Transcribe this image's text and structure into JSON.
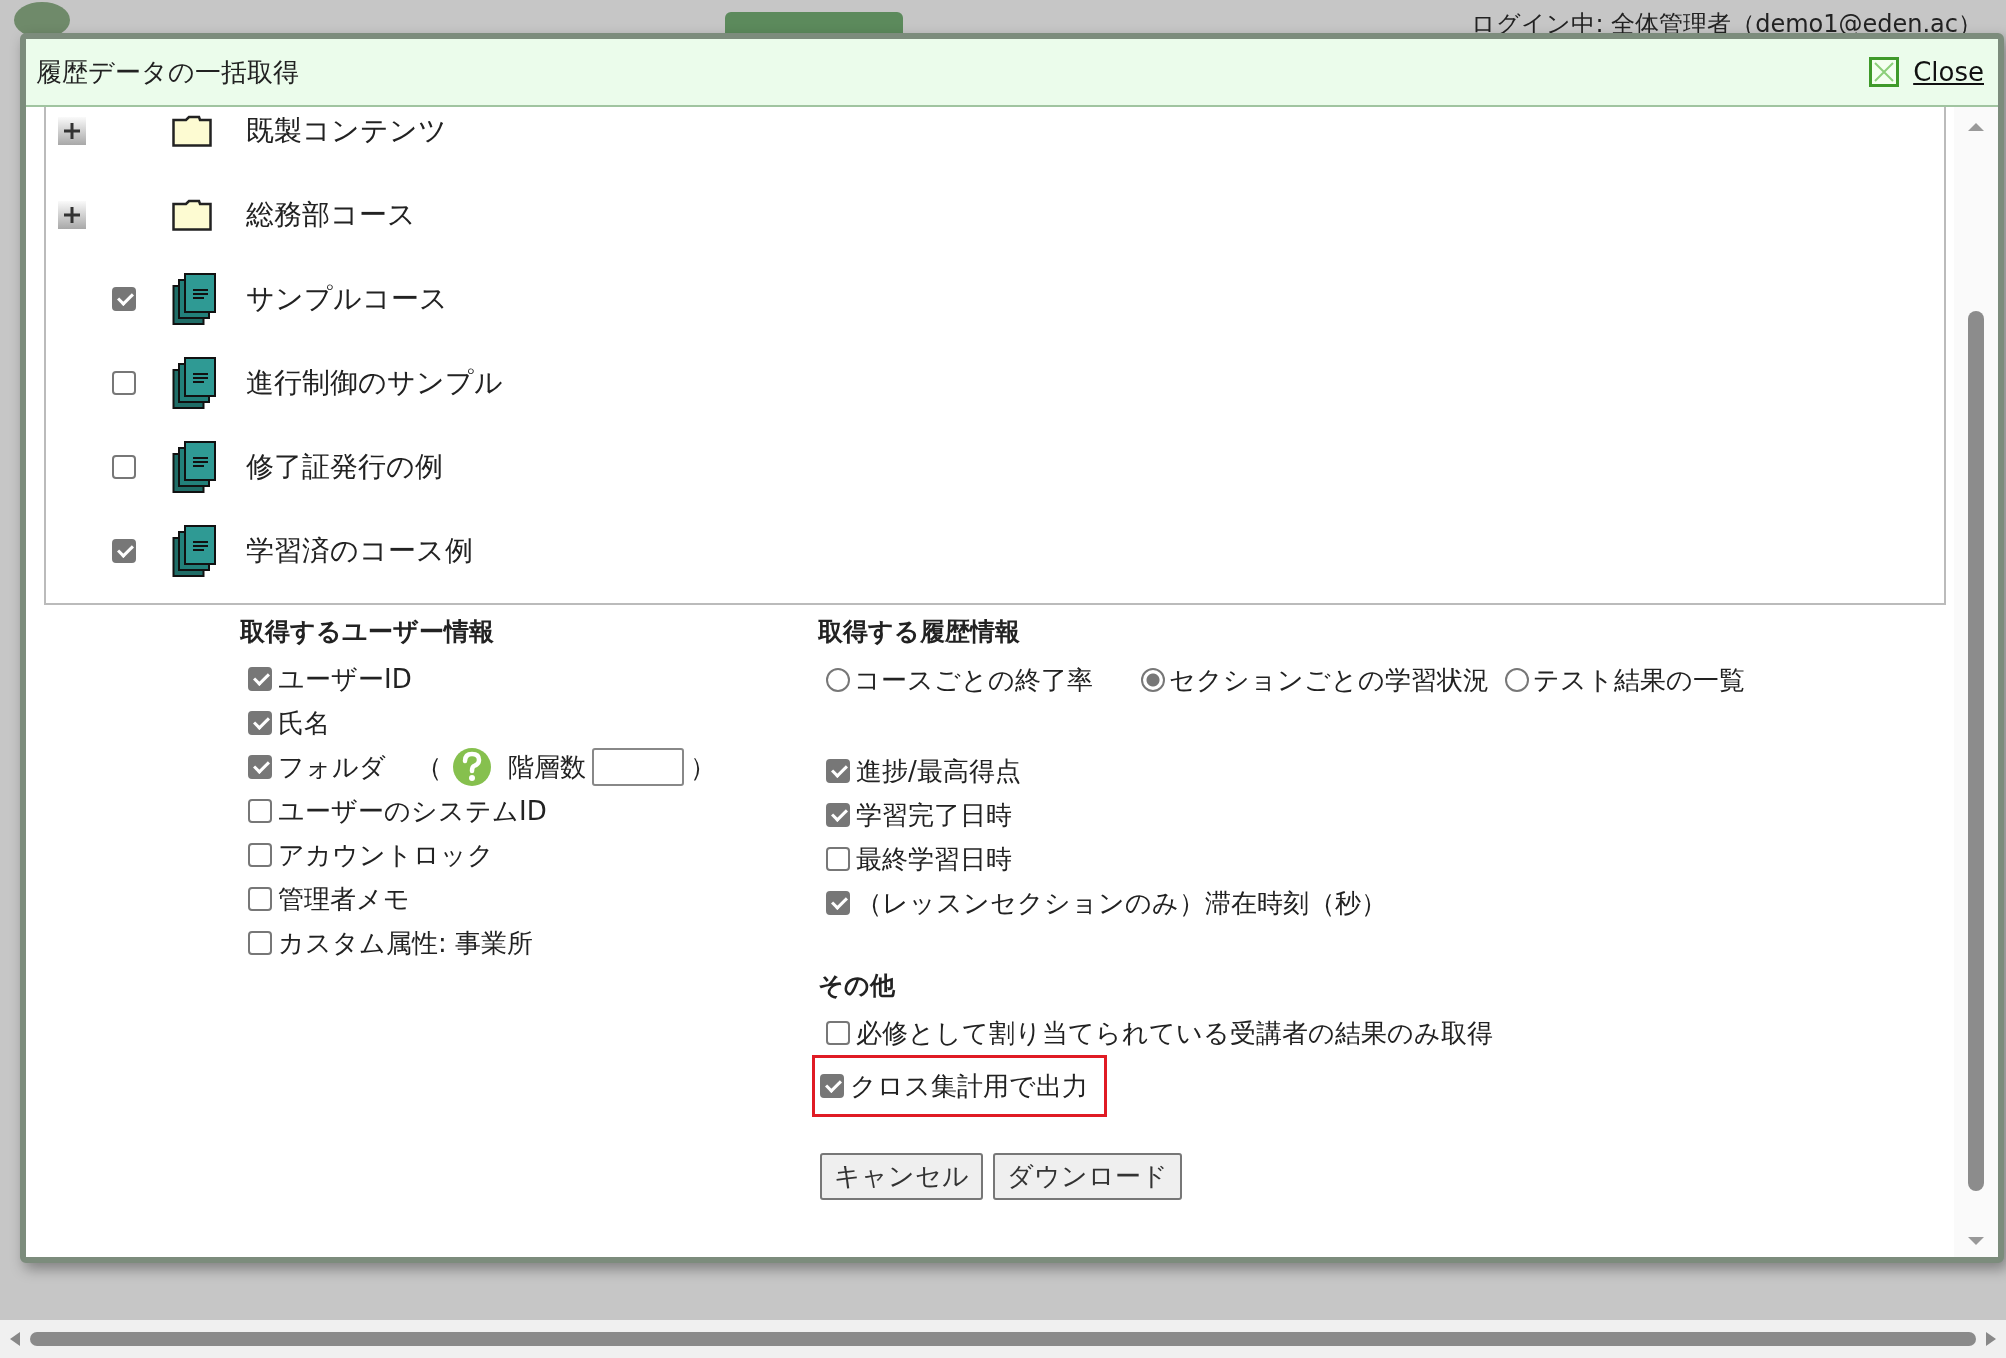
{
  "header": {
    "login": "ログイン中: 全体管理者（demo1@eden.ac）"
  },
  "dialog": {
    "title": "履歴データの一括取得",
    "close": "Close",
    "tree": [
      {
        "kind": "folder",
        "label": "既製コンテンツ",
        "expanded": false
      },
      {
        "kind": "folder",
        "label": "総務部コース",
        "expanded": false
      },
      {
        "kind": "course",
        "label": "サンプルコース",
        "checked": true
      },
      {
        "kind": "course",
        "label": "進行制御のサンプル",
        "checked": false
      },
      {
        "kind": "course",
        "label": "修了証発行の例",
        "checked": false
      },
      {
        "kind": "course",
        "label": "学習済のコース例",
        "checked": true
      }
    ],
    "user_info": {
      "heading": "取得するユーザー情報",
      "options": [
        {
          "kind": "plain",
          "label": "ユーザーID",
          "checked": true
        },
        {
          "kind": "plain",
          "label": "氏名",
          "checked": true
        },
        {
          "kind": "depth",
          "label": "フォルダ",
          "checked": true,
          "open": "（",
          "field_label": "階層数",
          "close": "）"
        },
        {
          "kind": "plain",
          "label": "ユーザーのシステムID",
          "checked": false
        },
        {
          "kind": "plain",
          "label": "アカウントロック",
          "checked": false
        },
        {
          "kind": "plain",
          "label": "管理者メモ",
          "checked": false
        },
        {
          "kind": "plain",
          "label": "カスタム属性: 事業所",
          "checked": false
        }
      ]
    },
    "history_info": {
      "heading": "取得する履歴情報",
      "modes": [
        {
          "label": "コースごとの終了率",
          "selected": false
        },
        {
          "label": "セクションごとの学習状況",
          "selected": true
        },
        {
          "label": "テスト結果の一覧",
          "selected": false
        }
      ],
      "options": [
        {
          "label": "進捗/最高得点",
          "checked": true
        },
        {
          "label": "学習完了日時",
          "checked": true
        },
        {
          "label": "最終学習日時",
          "checked": false
        },
        {
          "label": "（レッスンセクションのみ）滞在時刻（秒）",
          "checked": true
        }
      ]
    },
    "other": {
      "heading": "その他",
      "options": [
        {
          "label": "必修として割り当てられている受講者の結果のみ取得",
          "checked": false,
          "highlighted": false
        },
        {
          "label": "クロス集計用で出力",
          "checked": true,
          "highlighted": true
        }
      ]
    },
    "buttons": [
      "キャンセル",
      "ダウンロード"
    ]
  }
}
